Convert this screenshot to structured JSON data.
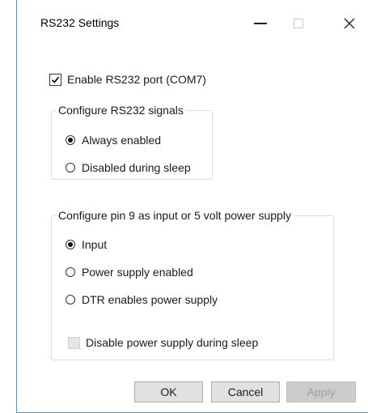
{
  "window": {
    "title": "RS232 Settings"
  },
  "enable_port": {
    "label": "Enable RS232 port (COM7)",
    "checked": true
  },
  "signals_group": {
    "legend": "Configure RS232 signals",
    "options": [
      {
        "label": "Always enabled",
        "selected": true
      },
      {
        "label": "Disabled during sleep",
        "selected": false
      }
    ]
  },
  "pin9_group": {
    "legend": "Configure pin 9 as input or 5 volt power supply",
    "options": [
      {
        "label": "Input",
        "selected": true
      },
      {
        "label": "Power supply enabled",
        "selected": false
      },
      {
        "label": "DTR enables power supply",
        "selected": false
      }
    ],
    "disable_sleep": {
      "label": "Disable power supply during sleep",
      "checked": false,
      "enabled": false
    }
  },
  "buttons": {
    "ok": "OK",
    "cancel": "Cancel",
    "apply": "Apply"
  },
  "icons": {
    "minimize": "minimize-icon",
    "maximize": "maximize-icon",
    "close": "close-icon"
  }
}
